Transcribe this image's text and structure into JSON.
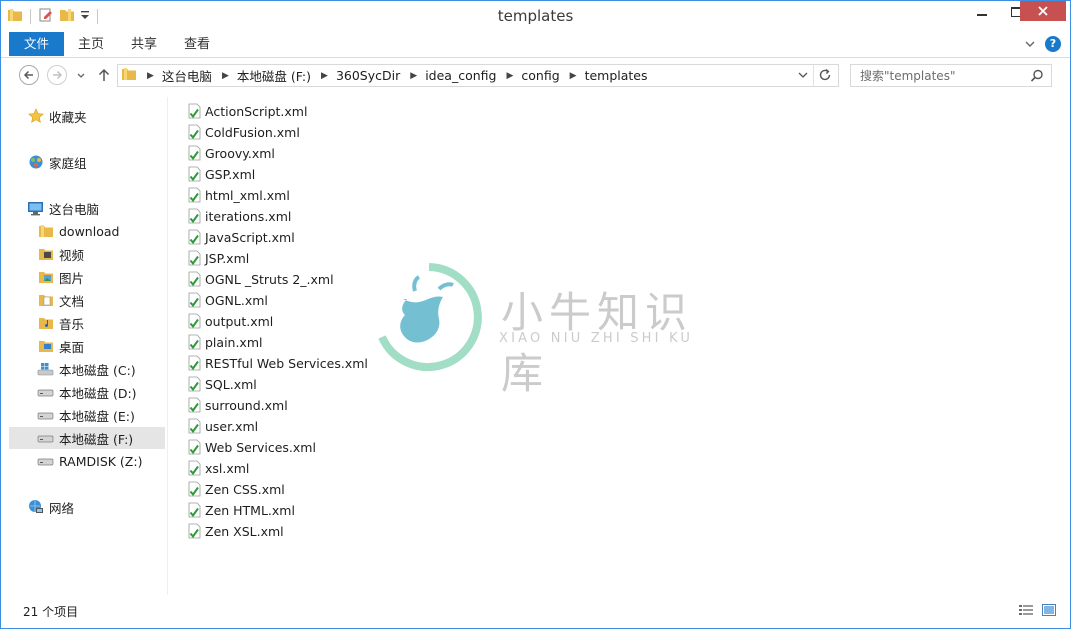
{
  "window": {
    "title": "templates"
  },
  "ribbon": {
    "tabs": [
      "文件",
      "主页",
      "共享",
      "查看"
    ],
    "help": "?"
  },
  "address": {
    "crumbs": [
      "这台电脑",
      "本地磁盘 (F:)",
      "360SycDir",
      "idea_config",
      "config",
      "templates"
    ]
  },
  "search": {
    "placeholder": "搜索\"templates\""
  },
  "sidebar": {
    "favorites": "收藏夹",
    "homegroup": "家庭组",
    "thispc": "这台电脑",
    "items": [
      "download",
      "视频",
      "图片",
      "文档",
      "音乐",
      "桌面",
      "本地磁盘 (C:)",
      "本地磁盘 (D:)",
      "本地磁盘 (E:)",
      "本地磁盘 (F:)",
      "RAMDISK (Z:)"
    ],
    "selected": "本地磁盘 (F:)",
    "network": "网络"
  },
  "files": [
    "ActionScript.xml",
    "ColdFusion.xml",
    "Groovy.xml",
    "GSP.xml",
    "html_xml.xml",
    "iterations.xml",
    "JavaScript.xml",
    "JSP.xml",
    "OGNL _Struts 2_.xml",
    "OGNL.xml",
    "output.xml",
    "plain.xml",
    "RESTful Web Services.xml",
    "SQL.xml",
    "surround.xml",
    "user.xml",
    "Web Services.xml",
    "xsl.xml",
    "Zen CSS.xml",
    "Zen HTML.xml",
    "Zen XSL.xml"
  ],
  "watermark": {
    "cn": "小牛知识库",
    "en": "XIAO NIU ZHI SHI KU"
  },
  "status": {
    "count": "21 个项目"
  },
  "colors": {
    "accent": "#1979ca",
    "close": "#c75050",
    "border": "#3c8ee3",
    "check": "#2e9b3a"
  }
}
